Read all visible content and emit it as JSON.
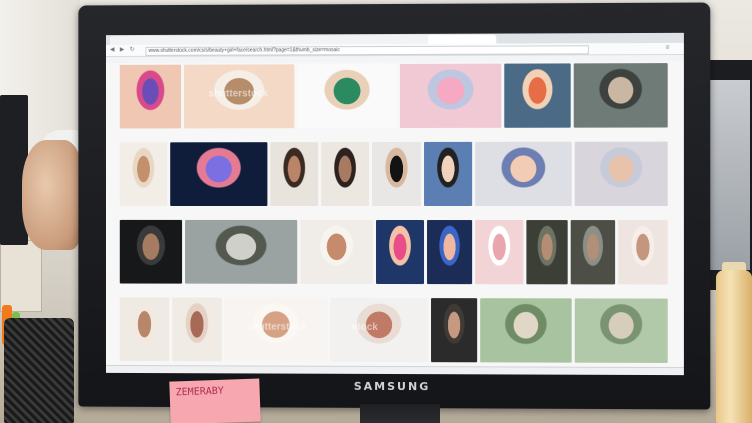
{
  "browser": {
    "tabs": [
      "",
      "",
      "",
      "",
      "",
      ""
    ],
    "url": "www.shutterstock.com/cs/s/beauty+girl+face/search.html?page=1&thumb_size=mosaic"
  },
  "grid": {
    "rows": [
      [
        {
          "w": 62,
          "tone": [
            "#f0c7b2",
            "#6b4db8",
            "#d94a8a"
          ]
        },
        {
          "w": 110,
          "tone": [
            "#f4d9c6",
            "#b68d6b",
            "#f5efe8"
          ],
          "watermark": "shutterstock"
        },
        {
          "w": 100,
          "tone": [
            "#fafafa",
            "#2b8a5f",
            "#e9d0b8"
          ]
        },
        {
          "w": 100,
          "tone": [
            "#f0c9d4",
            "#f7a9c4",
            "#bfc6e0"
          ]
        },
        {
          "w": 66,
          "tone": [
            "#4a6a86",
            "#e76d47",
            "#f2d1b5"
          ]
        },
        {
          "w": 92,
          "tone": [
            "#6f7b77",
            "#c9b7a4",
            "#3d423f"
          ]
        }
      ],
      [
        {
          "w": 48,
          "tone": [
            "#f2ede6",
            "#c4906b",
            "#e9d7c5"
          ]
        },
        {
          "w": 98,
          "tone": [
            "#0f1d3a",
            "#7b6fe2",
            "#e57a94"
          ]
        },
        {
          "w": 48,
          "tone": [
            "#e8e3dd",
            "#b98467",
            "#3a2a22"
          ]
        },
        {
          "w": 48,
          "tone": [
            "#ece7e1",
            "#a77b61",
            "#2e2220"
          ]
        },
        {
          "w": 48,
          "tone": [
            "#e9e7e5",
            "#131313",
            "#d8b89f"
          ]
        },
        {
          "w": 48,
          "tone": [
            "#5b7fb3",
            "#f0d2be",
            "#222"
          ]
        },
        {
          "w": 96,
          "tone": [
            "#dedee5",
            "#f2ccb4",
            "#6d7fb2"
          ]
        },
        {
          "w": 92,
          "tone": [
            "#d8d6dc",
            "#e8c3ab",
            "#c7cad9"
          ]
        }
      ],
      [
        {
          "w": 62,
          "tone": [
            "#17181a",
            "#a57c62",
            "#3a3a3a"
          ]
        },
        {
          "w": 112,
          "tone": [
            "#9aa3a1",
            "#cfd0ca",
            "#53594e"
          ]
        },
        {
          "w": 72,
          "tone": [
            "#f0ede9",
            "#c58b6c",
            "#f7f3ee"
          ]
        },
        {
          "w": 48,
          "tone": [
            "#1f3668",
            "#e84d8a",
            "#f2c1a6"
          ]
        },
        {
          "w": 44,
          "tone": [
            "#1b2d57",
            "#f0b8a0",
            "#3b66c7"
          ]
        },
        {
          "w": 48,
          "tone": [
            "#f2d3d6",
            "#e9a6ae",
            "#fff"
          ]
        },
        {
          "w": 40,
          "tone": [
            "#3b3f36",
            "#b48d74",
            "#6e7263"
          ]
        },
        {
          "w": 44,
          "tone": [
            "#4d4e46",
            "#b28f78",
            "#8c8f86"
          ]
        },
        {
          "w": 48,
          "tone": [
            "#efe5e0",
            "#c49680",
            "#f7eee9"
          ]
        }
      ],
      [
        {
          "w": 50,
          "tone": [
            "#efeae4",
            "#b8866b",
            "#f2e9e0"
          ]
        },
        {
          "w": 50,
          "tone": [
            "#f1ebe5",
            "#a76a56",
            "#e6d2c5"
          ]
        },
        {
          "w": 104,
          "tone": [
            "#f7f4f1",
            "#d6a286",
            "#fbf7f3"
          ],
          "watermark": "shutterstock"
        },
        {
          "w": 98,
          "tone": [
            "#f3f1ef",
            "#c07a65",
            "#e8dcd4"
          ],
          "watermark": "stock"
        },
        {
          "w": 46,
          "tone": [
            "#2b2b2b",
            "#c59a80",
            "#3f3a36"
          ]
        },
        {
          "w": 92,
          "tone": [
            "#a8c3a0",
            "#e0d7c7",
            "#6f8c66"
          ]
        },
        {
          "w": 92,
          "tone": [
            "#b1c9a9",
            "#d7cdbb",
            "#7a9471"
          ]
        }
      ]
    ]
  },
  "downloads": [
    "",
    "",
    ""
  ],
  "brand": "SAMSUNG",
  "sticky_note": "ZEMERABY"
}
